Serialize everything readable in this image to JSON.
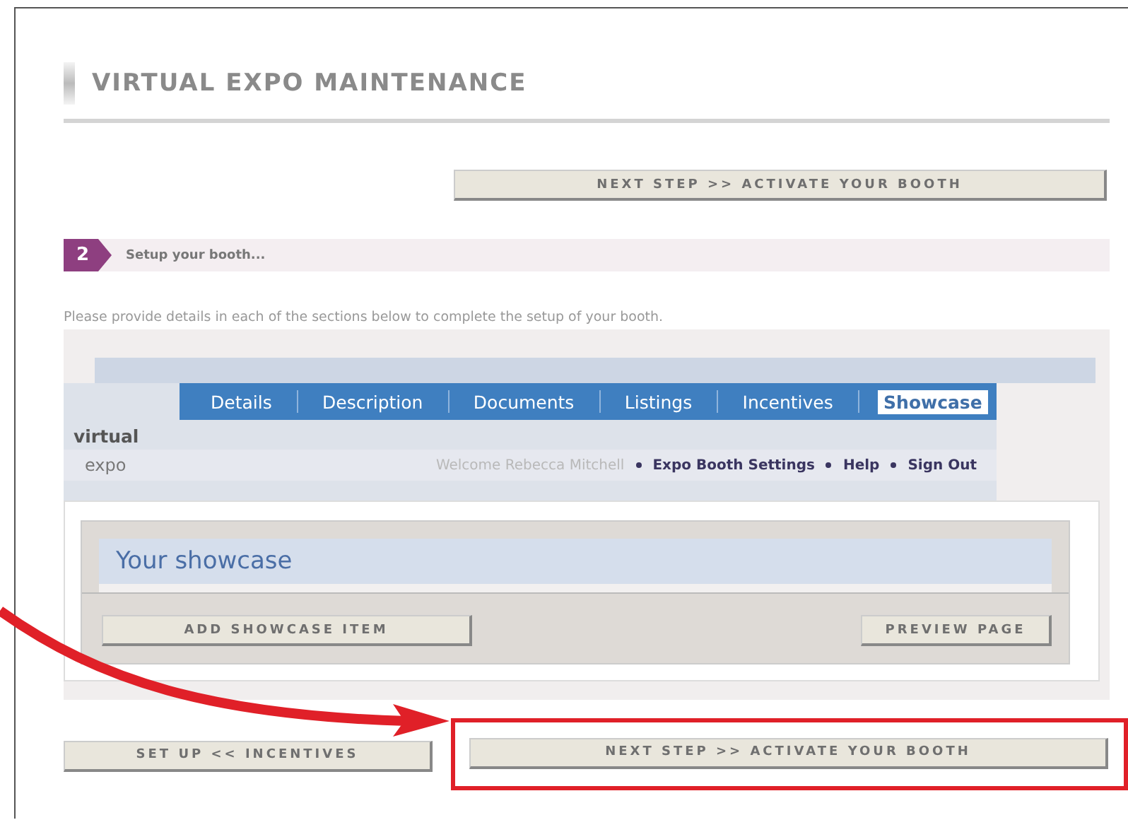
{
  "page_title": "VIRTUAL EXPO MAINTENANCE",
  "top_button": "NEXT STEP >> ACTIVATE YOUR BOOTH",
  "step": {
    "number": "2",
    "label": "Setup your booth..."
  },
  "instructions": "Please provide details in each of the sections below to complete the setup of your booth.",
  "tabs": [
    {
      "label": "Details",
      "selected": false
    },
    {
      "label": "Description",
      "selected": false
    },
    {
      "label": "Documents",
      "selected": false
    },
    {
      "label": "Listings",
      "selected": false
    },
    {
      "label": "Incentives",
      "selected": false
    },
    {
      "label": "Showcase",
      "selected": true
    }
  ],
  "brand": {
    "line_1": "virtual",
    "line_2": "expo"
  },
  "user_bar": {
    "welcome": "Welcome Rebecca Mitchell",
    "links": [
      "Expo Booth Settings",
      "Help",
      "Sign Out"
    ]
  },
  "showcase": {
    "heading": "Your showcase",
    "buttons": [
      "ADD SHOWCASE ITEM",
      "PREVIEW PAGE"
    ]
  },
  "bottom_buttons": [
    {
      "label": "SET UP << INCENTIVES",
      "highlighted": false
    },
    {
      "label": "NEXT STEP >> ACTIVATE YOUR BOOTH",
      "highlighted": true
    }
  ]
}
